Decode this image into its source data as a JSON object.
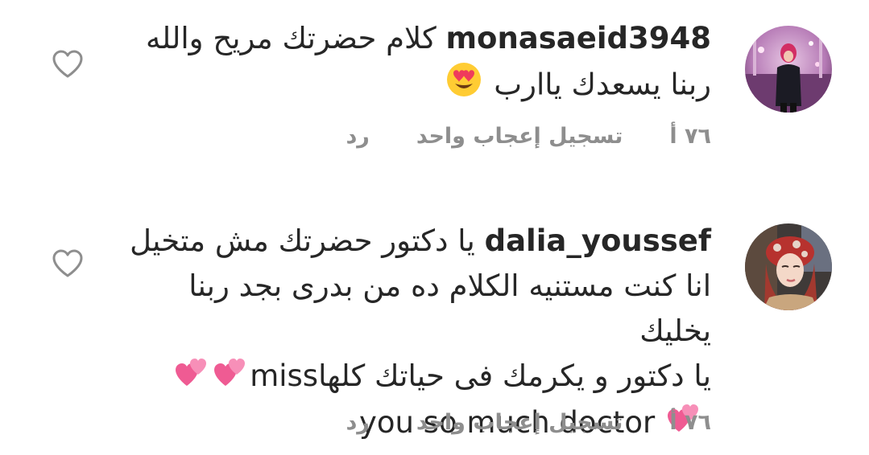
{
  "comments": [
    {
      "username": "monasaeid3948",
      "text": "كلام حضرتك مريح والله ربنا يسعدك ياارب",
      "emoji": "heart-eyes-emoji",
      "time": "٧٦ أ",
      "like_label": "تسجيل إعجاب واحد",
      "reply_label": "رد"
    },
    {
      "username": "dalia_youssef",
      "text_line1": "يا دكتور حضرتك مش متخيل",
      "text_line2": "انا كنت مستنيه الكلام ده من بدرى بجد ربنا يخليك",
      "text_line3": "يا دكتور و يكرمك فى حياتك كلها",
      "text_en1": "miss",
      "text_en2": "you so much doctor",
      "emoji": "two-hearts-emoji",
      "time": "٧٦ أ",
      "like_label": "تسجيل إعجاب واحد",
      "reply_label": "رد"
    }
  ],
  "icons": {
    "like": "heart-outline-icon"
  },
  "colors": {
    "text": "#262626",
    "meta": "#8e8e8e",
    "pink_heart": "#f06292"
  }
}
